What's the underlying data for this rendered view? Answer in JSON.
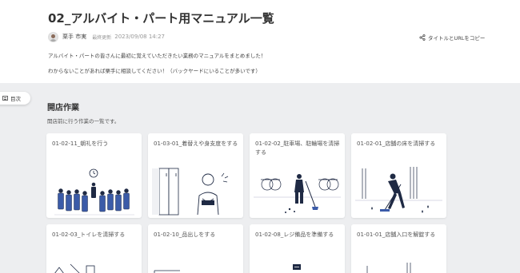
{
  "page": {
    "title": "02_アルバイト・パート用マニュアル一覧",
    "author": "栗手 市実",
    "updated_label": "最終更新",
    "updated_date": "2023/09/08 14:27",
    "copy_label": "タイトルとURLをコピー",
    "description_line1": "アルバイト・パートの皆さんに最初に覚えていただきたい業務のマニュアルをまとめました！",
    "description_line2": "わからないことがあれば栗手に相談してください！（バックヤードにいることが多いです）"
  },
  "toc": {
    "label": "目次"
  },
  "section": {
    "title": "開店作業",
    "description": "開店前に行う作業の一覧です。"
  },
  "cards": [
    {
      "title": "01-02-11_朝礼を行う",
      "icon": "morning-meeting-illustration"
    },
    {
      "title": "01-03-01_着替えや身支度をする",
      "icon": "locker-room-illustration"
    },
    {
      "title": "01-02-02_駐車場、駐輪場を清掃する",
      "icon": "parking-cleaning-illustration"
    },
    {
      "title": "01-02-01_店舗の床を清掃する",
      "icon": "floor-cleaning-illustration"
    },
    {
      "title": "01-02-03_トイレを清掃する",
      "icon": "toilet-illustration"
    },
    {
      "title": "01-02-10_品出しをする",
      "icon": "stocking-illustration"
    },
    {
      "title": "01-02-08_レジ備品を準備する",
      "icon": "register-illustration"
    },
    {
      "title": "01-01-01_店舗入口を解錠する",
      "icon": "entrance-illustration"
    }
  ],
  "colors": {
    "background": "#edeef0",
    "card": "#ffffff",
    "text": "#333333",
    "illustration_line": "#1f2a44",
    "illustration_accent": "#3b5ba8"
  }
}
